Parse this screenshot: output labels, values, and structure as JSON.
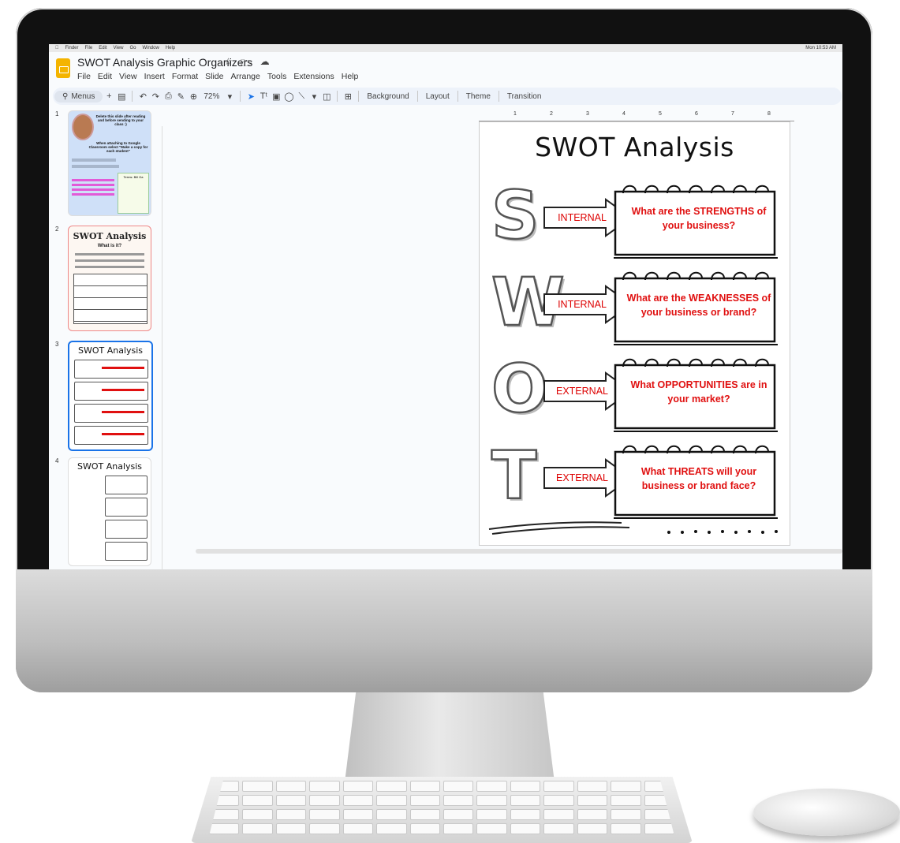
{
  "app": {
    "mac_menu": [
      "Finder",
      "File",
      "Edit",
      "View",
      "Go",
      "Window",
      "Help"
    ],
    "mac_clock": "Mon 10:53 AM",
    "title": "SWOT Analysis Graphic Organizers",
    "menus": [
      "File",
      "Edit",
      "View",
      "Insert",
      "Format",
      "Slide",
      "Arrange",
      "Tools",
      "Extensions",
      "Help"
    ]
  },
  "toolbar": {
    "search_label": "Menus",
    "zoom": "72%",
    "background_label": "Background",
    "layout_label": "Layout",
    "theme_label": "Theme",
    "transition_label": "Transition"
  },
  "filmstrip": {
    "slides": [
      {
        "number": "1",
        "heading": "Delete this slide after reading and before sending to your class :)",
        "subheading": "When attaching to Google Classroom select \"Make a copy for each student\"",
        "side_title": "Terms: Bill Ga"
      },
      {
        "number": "2",
        "heading": "SWOT Analysis",
        "subheading": "What is it?"
      },
      {
        "number": "3",
        "heading": "SWOT Analysis"
      },
      {
        "number": "4",
        "heading": "SWOT Analysis"
      }
    ]
  },
  "ruler": {
    "marks": [
      "1",
      "2",
      "3",
      "4",
      "5",
      "6",
      "7",
      "8"
    ]
  },
  "slide": {
    "title": "SWOT Analysis",
    "rows": [
      {
        "letter": "S",
        "label": "INTERNAL",
        "question": "What are the STRENGTHS of your business?"
      },
      {
        "letter": "W",
        "label": "INTERNAL",
        "question": "What are the WEAKNESSES of your business or brand?"
      },
      {
        "letter": "O",
        "label": "EXTERNAL",
        "question": "What OPPORTUNITIES are in your market?"
      },
      {
        "letter": "T",
        "label": "EXTERNAL",
        "question": "What THREATS will your business or brand face?"
      }
    ]
  },
  "colors": {
    "accent": "#1a73e8",
    "question_red": "#e01010",
    "label_red": "#dd0000",
    "app_logo": "#f4b400"
  }
}
